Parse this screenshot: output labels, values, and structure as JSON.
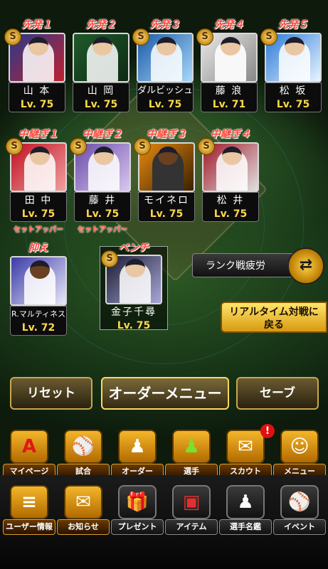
{
  "starters": [
    {
      "role": "先発１",
      "name": "山 本",
      "level": "Lv. 75"
    },
    {
      "role": "先発２",
      "name": "山 岡",
      "level": "Lv. 75"
    },
    {
      "role": "先発３",
      "name": "ダルビッシュ",
      "level": "Lv. 75"
    },
    {
      "role": "先発４",
      "name": "藤 浪",
      "level": "Lv. 71"
    },
    {
      "role": "先発５",
      "name": "松 坂",
      "level": "Lv. 75"
    }
  ],
  "relievers": [
    {
      "role": "中継ぎ１",
      "name": "田 中",
      "level": "Lv. 75",
      "sub": "セットアッパー"
    },
    {
      "role": "中継ぎ２",
      "name": "藤 井",
      "level": "Lv. 75",
      "sub": "セットアッパー"
    },
    {
      "role": "中継ぎ３",
      "name": "モイネロ",
      "level": "Lv. 75",
      "sub": ""
    },
    {
      "role": "中継ぎ４",
      "name": "松 井",
      "level": "Lv. 75",
      "sub": ""
    }
  ],
  "closer": {
    "role": "抑え",
    "name": "R.マルティネス",
    "level": "Lv. 72"
  },
  "bench": {
    "role": "ベンチ",
    "name": "金子千尋",
    "level": "Lv. 75"
  },
  "badge_letter": "S",
  "rank_fatigue_label": "ランク戦疲労",
  "realtime_label_1": "リアルタイム対戦に",
  "realtime_label_2": "戻る",
  "buttons": {
    "reset": "リセット",
    "order_menu": "オーダーメニュー",
    "save": "セーブ"
  },
  "nav_row1": [
    {
      "label": "マイページ",
      "icon": "A"
    },
    {
      "label": "試合",
      "icon": "⚾"
    },
    {
      "label": "オーダー",
      "icon": "♟"
    },
    {
      "label": "選手",
      "icon": "♟"
    },
    {
      "label": "スカウト",
      "icon": "✉"
    },
    {
      "label": "メニュー",
      "icon": "☺"
    }
  ],
  "scout_notify": "!",
  "nav_row2": [
    {
      "label": "ユーザー情報",
      "icon": "≡"
    },
    {
      "label": "お知らせ",
      "icon": "✉"
    },
    {
      "label": "プレゼント",
      "icon": "🎁"
    },
    {
      "label": "アイテム",
      "icon": "▣"
    },
    {
      "label": "選手名鑑",
      "icon": "♟"
    },
    {
      "label": "イベント",
      "icon": "⚾"
    }
  ],
  "colors": {
    "role_red": "#ff4a3a",
    "level_yellow": "#ffd84a",
    "gold": "#ffd860"
  }
}
